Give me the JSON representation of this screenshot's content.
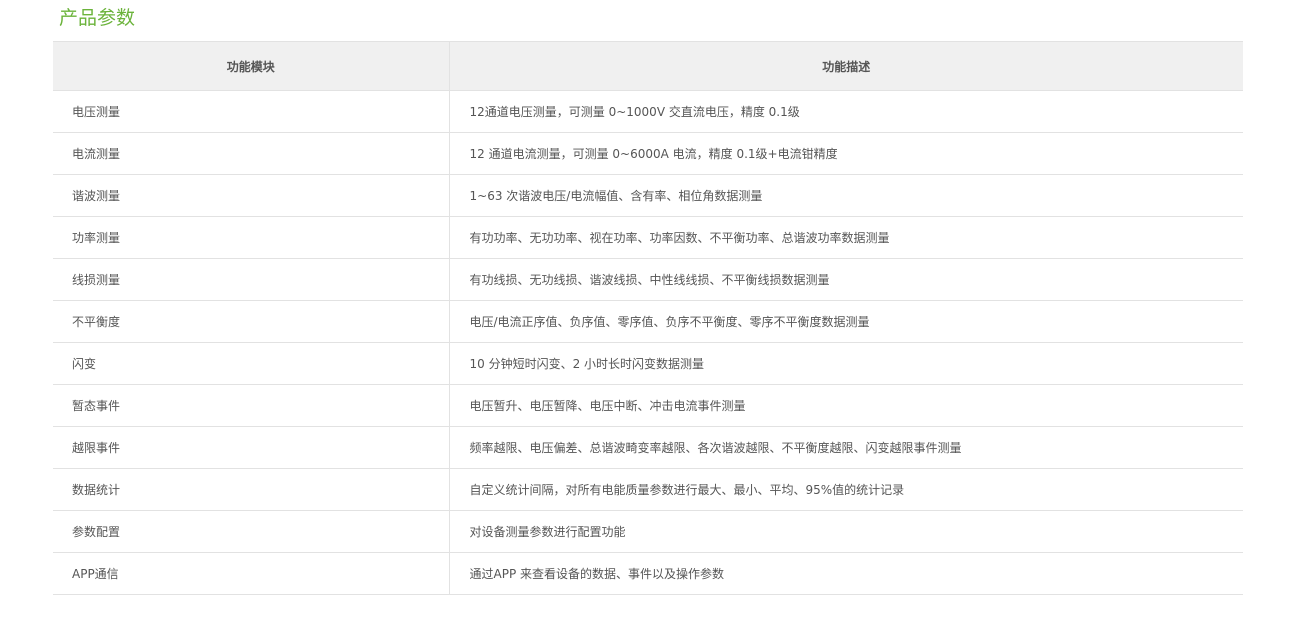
{
  "title": "产品参数",
  "table": {
    "headers": [
      "功能模块",
      "功能描述"
    ],
    "rows": [
      {
        "module": "电压测量",
        "desc": "12通道电压测量，可测量 0~1000V 交直流电压，精度 0.1级"
      },
      {
        "module": "电流测量",
        "desc": "12 通道电流测量，可测量 0~6000A 电流，精度 0.1级+电流钳精度"
      },
      {
        "module": "谐波测量",
        "desc": "1~63 次谐波电压/电流幅值、含有率、相位角数据测量"
      },
      {
        "module": "功率测量",
        "desc": "有功功率、无功功率、视在功率、功率因数、不平衡功率、总谐波功率数据测量"
      },
      {
        "module": "线损测量",
        "desc": "有功线损、无功线损、谐波线损、中性线线损、不平衡线损数据测量"
      },
      {
        "module": "不平衡度",
        "desc": "电压/电流正序值、负序值、零序值、负序不平衡度、零序不平衡度数据测量"
      },
      {
        "module": "闪变",
        "desc": "10 分钟短时闪变、2 小时长时闪变数据测量"
      },
      {
        "module": "暂态事件",
        "desc": "电压暂升、电压暂降、电压中断、冲击电流事件测量"
      },
      {
        "module": "越限事件",
        "desc": "频率越限、电压偏差、总谐波畸变率越限、各次谐波越限、不平衡度越限、闪变越限事件测量"
      },
      {
        "module": "数据统计",
        "desc": "自定义统计间隔，对所有电能质量参数进行最大、最小、平均、95%值的统计记录"
      },
      {
        "module": "参数配置",
        "desc": "对设备测量参数进行配置功能"
      },
      {
        "module": "APP通信",
        "desc": "通过APP 来查看设备的数据、事件以及操作参数"
      }
    ]
  },
  "colors": {
    "title": "#6bb33b",
    "header_bg": "#f0f0f0",
    "border": "#e2e2e2",
    "text": "#555555"
  }
}
